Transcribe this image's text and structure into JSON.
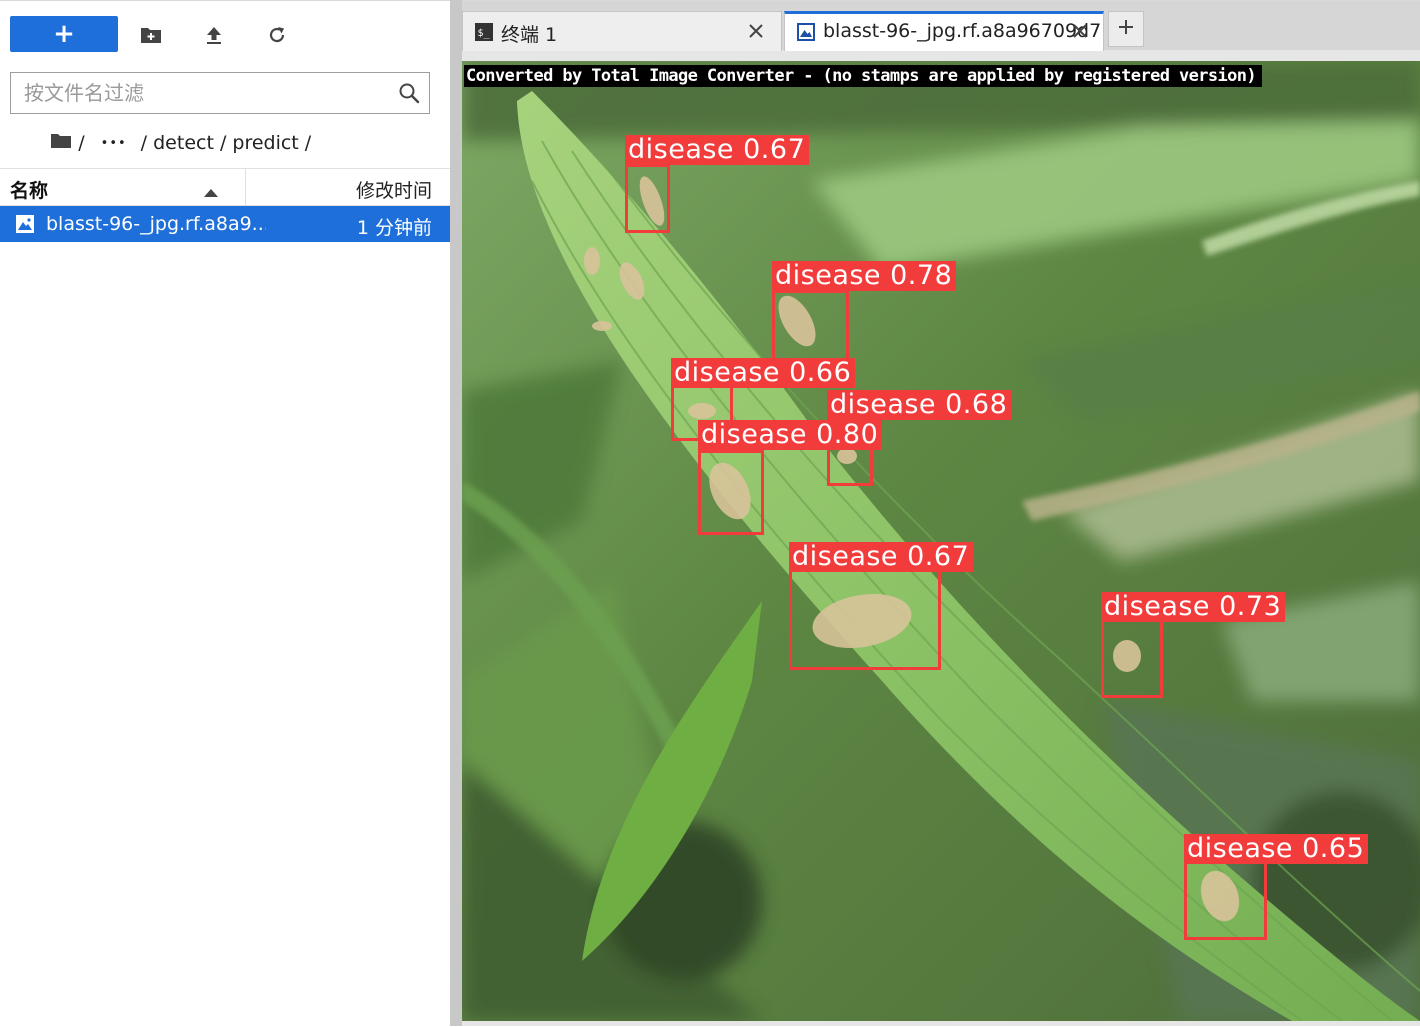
{
  "file_browser": {
    "toolbar": {
      "new_label": "+",
      "icons": [
        "new-folder-icon",
        "upload-icon",
        "refresh-icon"
      ]
    },
    "filter": {
      "placeholder": "按文件名过滤",
      "value": ""
    },
    "breadcrumb": {
      "root": "/",
      "ellipsis": "•••",
      "path": "/ detect / predict /"
    },
    "columns": {
      "name": "名称",
      "modified": "修改时间",
      "sort": "ascending"
    },
    "files": [
      {
        "name": "blasst-96-_jpg.rf.a8a9...",
        "modified": "1 分钟前",
        "selected": true
      }
    ]
  },
  "tabs": [
    {
      "label": "终端 1",
      "icon": "terminal-icon",
      "active": false
    },
    {
      "label": "blasst-96-_jpg.rf.a8a96709d7",
      "icon": "image-file-icon",
      "active": true
    }
  ],
  "viewer": {
    "watermark": "Converted by Total Image Converter - (no stamps are applied by registered version)",
    "detections": [
      {
        "label": "disease 0.67"
      },
      {
        "label": "disease 0.78"
      },
      {
        "label": "disease 0.66"
      },
      {
        "label": "disease 0.68"
      },
      {
        "label": "disease 0.80"
      },
      {
        "label": "disease 0.67"
      },
      {
        "label": "disease 0.73"
      },
      {
        "label": "disease 0.65"
      }
    ]
  },
  "colors": {
    "accent": "#1e6fd9",
    "detection": "#f23c3c"
  }
}
